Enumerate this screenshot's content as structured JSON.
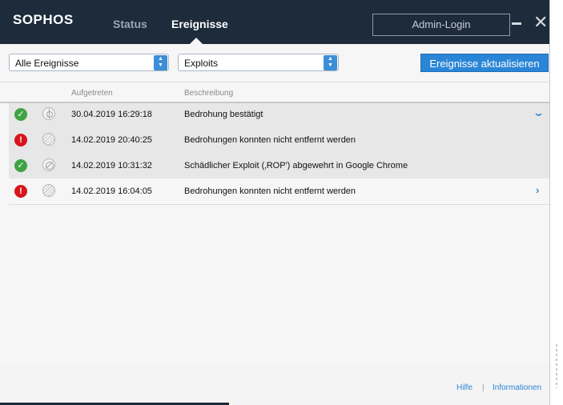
{
  "header": {
    "logo": "SOPHOS",
    "tabs": [
      {
        "label": "Status",
        "active": false
      },
      {
        "label": "Ereignisse",
        "active": true
      }
    ],
    "admin_login": "Admin-Login",
    "minimize_icon": "minimize-icon",
    "close_icon": "close-icon"
  },
  "toolbar": {
    "filter_type": "Alle Ereignisse",
    "filter_category": "Exploits",
    "refresh_label": "Ereignisse aktualisieren"
  },
  "table": {
    "columns": {
      "time": "Aufgetreten",
      "description": "Beschreibung"
    },
    "rows": [
      {
        "status": "ok",
        "type": "target",
        "time": "30.04.2019 16:29:18",
        "description": "Bedrohung bestätigt",
        "chevron": "down"
      },
      {
        "status": "error",
        "type": "wave",
        "time": "14.02.2019 20:40:25",
        "description": "Bedrohungen konnten nicht entfernt werden",
        "chevron": ""
      },
      {
        "status": "ok",
        "type": "block",
        "time": "14.02.2019 10:31:32",
        "description": "Schädlicher Exploit (‚ROP') abgewehrt in Google Chrome",
        "chevron": ""
      },
      {
        "status": "error",
        "type": "wave",
        "time": "14.02.2019 16:04:05",
        "description": "Bedrohungen konnten nicht entfernt werden",
        "chevron": "right"
      }
    ]
  },
  "footer": {
    "help": "Hilfe",
    "separator": "|",
    "info": "Informationen"
  },
  "colors": {
    "header_bg": "#1d2b3b",
    "accent": "#2a85d6",
    "ok": "#3fa344",
    "error": "#d8141c"
  }
}
